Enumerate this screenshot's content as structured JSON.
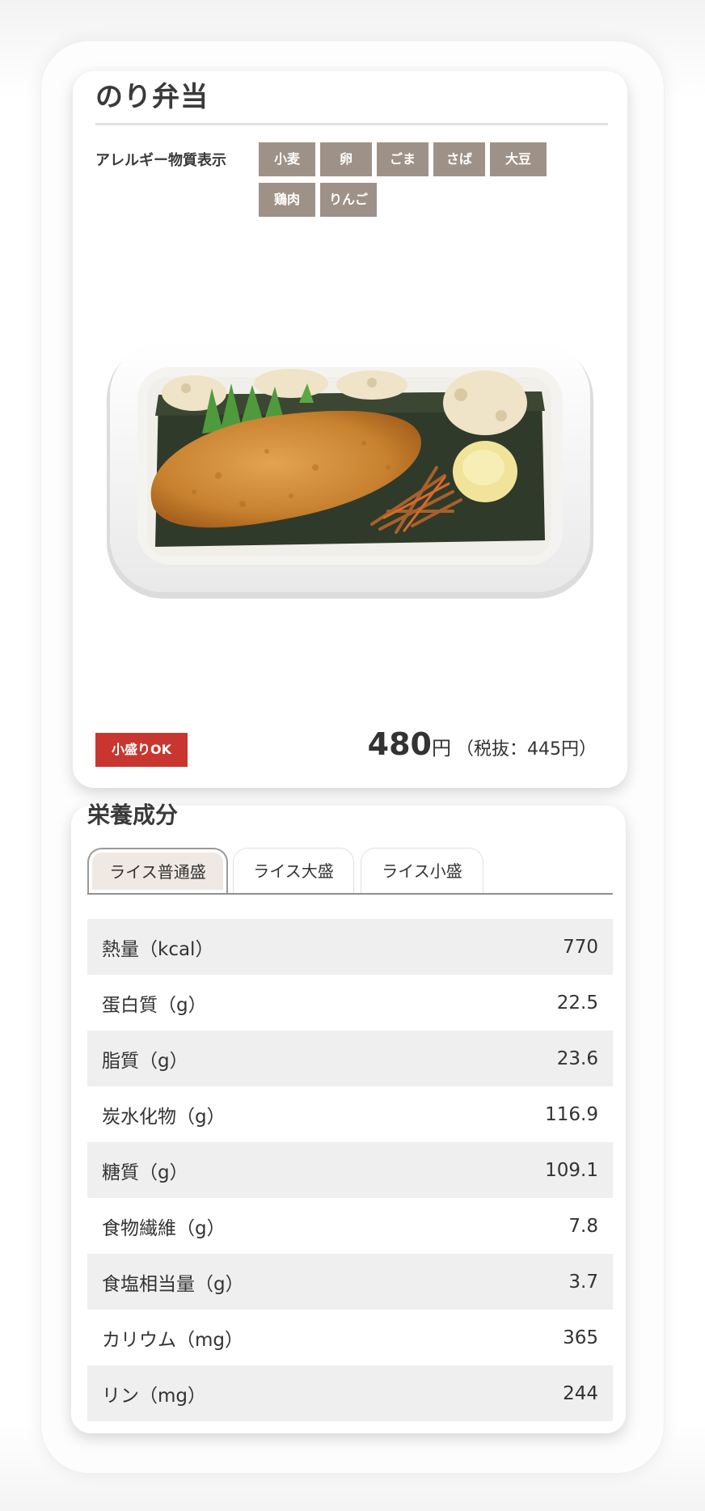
{
  "product": {
    "name": "のり弁当",
    "allergy_label": "アレルギー物質表示",
    "allergens": [
      "小麦",
      "卵",
      "ごま",
      "さば",
      "大豆",
      "鶏肉",
      "りんご"
    ],
    "small_ok_badge": "小盛りOK",
    "price": "480",
    "price_unit": "円",
    "price_tax_excluded": "（税抜：445円）"
  },
  "nutrition": {
    "title": "栄養成分",
    "tabs": [
      {
        "label": "ライス普通盛",
        "active": true
      },
      {
        "label": "ライス大盛",
        "active": false
      },
      {
        "label": "ライス小盛",
        "active": false
      }
    ],
    "rows": [
      {
        "label": "熱量（kcal）",
        "value": "770"
      },
      {
        "label": "蛋白質（g）",
        "value": "22.5"
      },
      {
        "label": "脂質（g）",
        "value": "23.6"
      },
      {
        "label": "炭水化物（g）",
        "value": "116.9"
      },
      {
        "label": "糖質（g）",
        "value": "109.1"
      },
      {
        "label": "食物繊維（g）",
        "value": "7.8"
      },
      {
        "label": "食塩相当量（g）",
        "value": "3.7"
      },
      {
        "label": "カリウム（mg）",
        "value": "365"
      },
      {
        "label": "リン（mg）",
        "value": "244"
      }
    ]
  },
  "colors": {
    "allergen_tag": "#9e9288",
    "small_ok_badge": "#c8372f",
    "active_tab": "#efe8e3",
    "row_shade": "#efefef"
  }
}
